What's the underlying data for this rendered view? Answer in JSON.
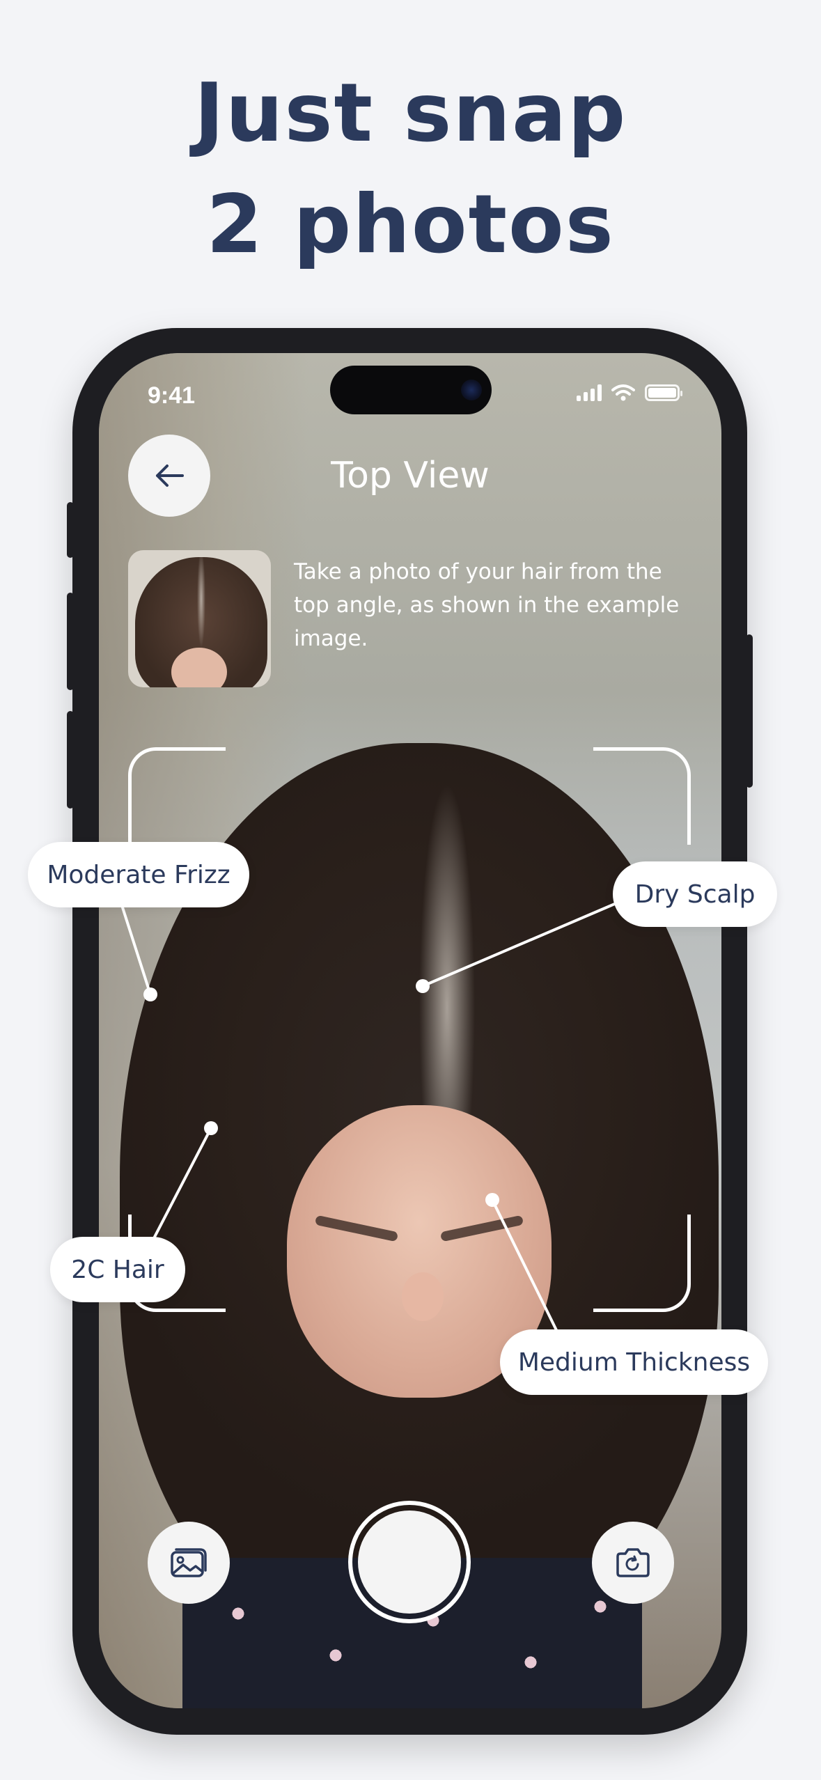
{
  "headline": {
    "line1": "Just snap",
    "line2": "2 photos"
  },
  "status_bar": {
    "time": "9:41"
  },
  "camera_screen": {
    "title": "Top View",
    "instructions": "Take a photo of your hair from the top angle, as shown in the example image."
  },
  "annotations": [
    {
      "label": "Moderate Frizz"
    },
    {
      "label": "Dry Scalp"
    },
    {
      "label": "2C Hair"
    },
    {
      "label": "Medium Thickness"
    }
  ],
  "icons": {
    "back": "arrow-left-icon",
    "gallery": "image-gallery-icon",
    "flip": "camera-flip-icon",
    "shutter": "shutter-icon"
  },
  "colors": {
    "headline": "#2b3a5c",
    "background": "#f3f4f7",
    "phone_frame": "#1e1e22",
    "pill_bg": "#ffffff",
    "pill_text": "#2b3a5c"
  }
}
